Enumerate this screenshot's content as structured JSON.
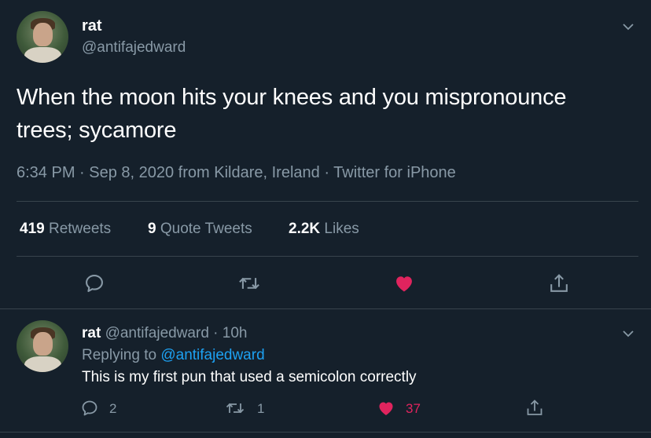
{
  "tweet": {
    "display_name": "rat",
    "handle": "@antifajedward",
    "text_line1": "When the moon hits your knees and you mispronounce",
    "text_line2": "trees; sycamore",
    "meta": "6:34 PM · Sep 8, 2020 from Kildare, Ireland · Twitter for iPhone",
    "stats": {
      "retweets_count": "419",
      "retweets_label": "Retweets",
      "quotes_count": "9",
      "quotes_label": "Quote Tweets",
      "likes_count": "2.2K",
      "likes_label": "Likes"
    },
    "liked": true,
    "icons": [
      "reply-icon",
      "retweet-icon",
      "like-icon",
      "share-icon",
      "chevron-down-icon"
    ]
  },
  "reply": {
    "display_name": "rat",
    "handle_time": "@antifajedward · 10h",
    "replying_prefix": "Replying to",
    "replying_to": "@antifajedward",
    "text": "This is my first pun that used a semicolon correctly",
    "reply_count": "2",
    "retweet_count": "1",
    "like_count": "37",
    "liked": true
  },
  "colors": {
    "background": "#15202b",
    "text": "#ffffff",
    "muted": "#8899a6",
    "link": "#1da1f2",
    "like": "#e0245e",
    "divider": "#38444d"
  }
}
